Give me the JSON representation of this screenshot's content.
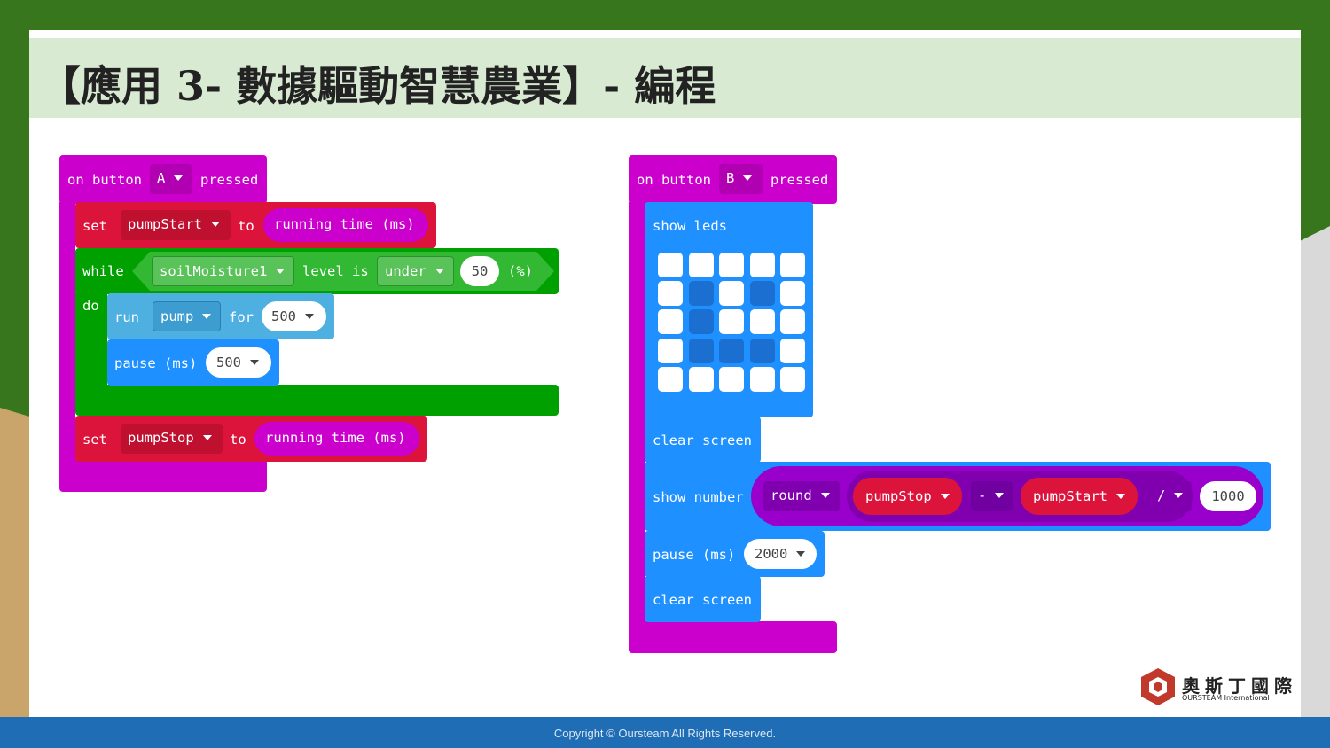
{
  "slide": {
    "title": "【應用 3- 數據驅動智慧農業】- 編程",
    "footer": "Copyright © Oursteam All Rights Reserved."
  },
  "logo": {
    "name_cn": "奧斯丁國際",
    "name_en": "OURSTEAM International"
  },
  "colors": {
    "magenta": "#cc00cc",
    "red": "#dc143c",
    "green": "#00a000",
    "lightblue": "#4eb0e0",
    "blue": "#1e90ff",
    "purple": "#9900cc"
  },
  "programA": {
    "event": {
      "on": "on button",
      "button": "A",
      "pressed": "pressed"
    },
    "set1": {
      "set": "set",
      "var": "pumpStart",
      "to": "to",
      "value": "running time (ms)"
    },
    "while": {
      "while": "while",
      "sensor": "soilMoisture1",
      "level_is": "level is",
      "cond": "under",
      "threshold": "50",
      "unit": "(%)",
      "do": "do"
    },
    "run": {
      "run": "run",
      "device": "pump",
      "for": "for",
      "duration": "500"
    },
    "pause": {
      "label": "pause (ms)",
      "value": "500"
    },
    "set2": {
      "set": "set",
      "var": "pumpStop",
      "to": "to",
      "value": "running time (ms)"
    }
  },
  "programB": {
    "event": {
      "on": "on button",
      "button": "B",
      "pressed": "pressed"
    },
    "show_leds": "show leds",
    "leds": [
      [
        0,
        0,
        0,
        0,
        0
      ],
      [
        0,
        1,
        0,
        1,
        0
      ],
      [
        0,
        1,
        0,
        0,
        0
      ],
      [
        0,
        1,
        1,
        1,
        0
      ],
      [
        0,
        0,
        0,
        0,
        0
      ]
    ],
    "clear1": "clear screen",
    "show_number": {
      "label": "show number",
      "round": "round",
      "left": "pumpStop",
      "minus": "-",
      "right": "pumpStart",
      "divide": "/",
      "divisor": "1000"
    },
    "pause": {
      "label": "pause (ms)",
      "value": "2000"
    },
    "clear2": "clear screen"
  }
}
